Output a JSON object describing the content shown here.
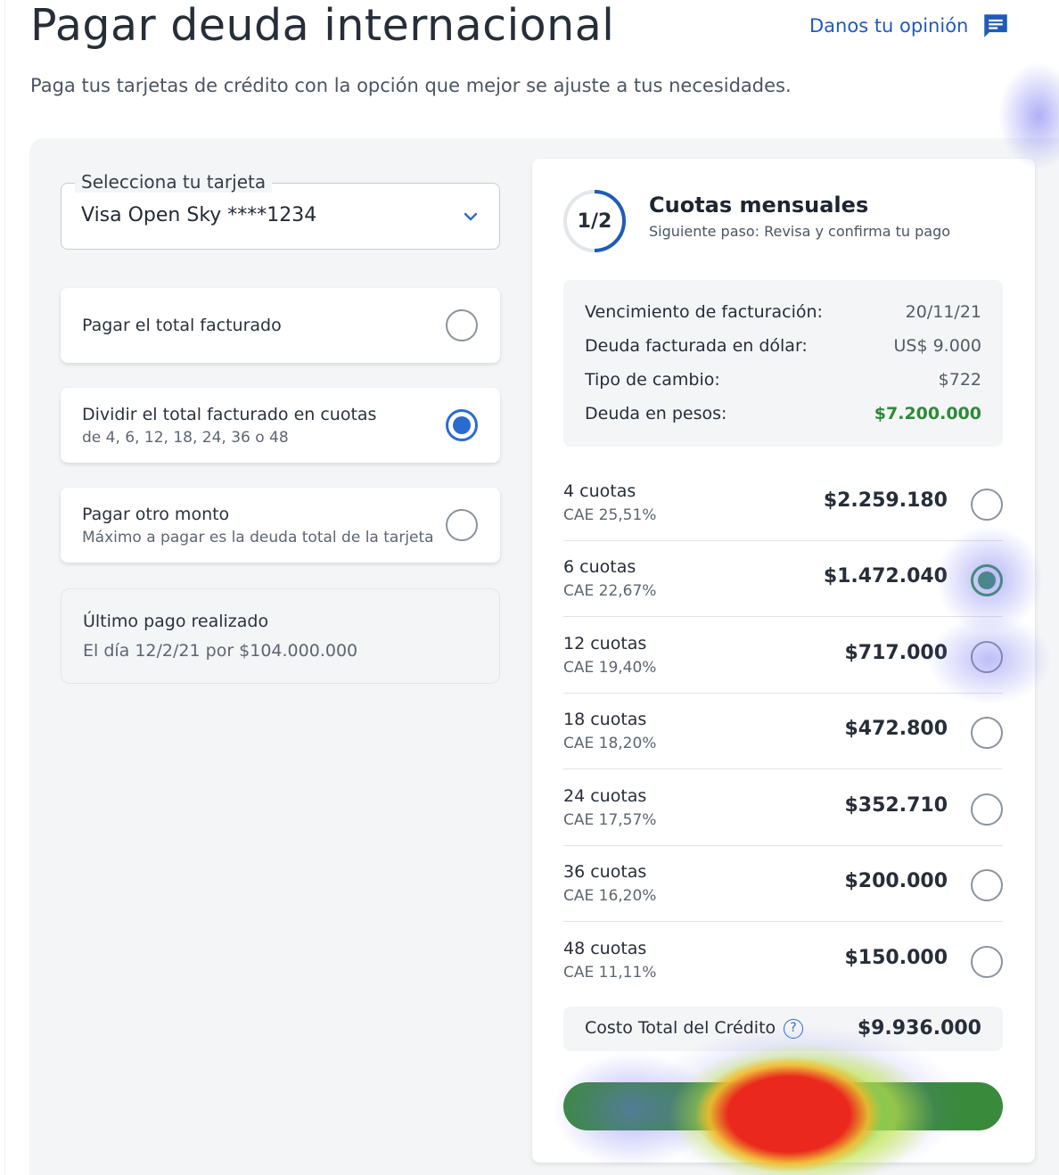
{
  "header": {
    "title": "Pagar deuda internacional",
    "feedback_label": "Danos tu opinión",
    "subtitle": "Paga tus tarjetas de crédito con la opción que mejor se ajuste a tus necesidades."
  },
  "card_select": {
    "label": "Selecciona tu tarjeta",
    "value": "Visa Open Sky ****1234"
  },
  "payment_options": [
    {
      "title": "Pagar el total facturado",
      "subtitle": "",
      "selected": false
    },
    {
      "title": "Dividir el total facturado en cuotas",
      "subtitle": "de 4, 6, 12, 18, 24, 36 o 48",
      "selected": true
    },
    {
      "title": "Pagar otro monto",
      "subtitle": "Máximo a pagar es la deuda total de la tarjeta",
      "selected": false
    }
  ],
  "last_payment": {
    "title": "Último pago realizado",
    "detail": "El día 12/2/21 por $104.000.000"
  },
  "step": {
    "indicator": "1/2",
    "progress": 0.5,
    "title": "Cuotas mensuales",
    "next": "Siguiente paso: Revisa y confirma tu pago"
  },
  "summary": [
    {
      "label": "Vencimiento de facturación:",
      "value": "20/11/21"
    },
    {
      "label": "Deuda facturada en dólar:",
      "value": "US$ 9.000"
    },
    {
      "label": "Tipo de cambio:",
      "value": "$722"
    },
    {
      "label": "Deuda en pesos:",
      "value": "$7.200.000"
    }
  ],
  "installments": [
    {
      "name": "4 cuotas",
      "cae": "CAE 25,51%",
      "amount": "$2.259.180",
      "selected": false
    },
    {
      "name": "6 cuotas",
      "cae": "CAE 22,67%",
      "amount": "$1.472.040",
      "selected": true
    },
    {
      "name": "12 cuotas",
      "cae": "CAE 19,40%",
      "amount": "$717.000",
      "selected": false
    },
    {
      "name": "18 cuotas",
      "cae": "CAE 18,20%",
      "amount": "$472.800",
      "selected": false
    },
    {
      "name": "24 cuotas",
      "cae": "CAE 17,57%",
      "amount": "$352.710",
      "selected": false
    },
    {
      "name": "36 cuotas",
      "cae": "CAE 16,20%",
      "amount": "$200.000",
      "selected": false
    },
    {
      "name": "48 cuotas",
      "cae": "CAE 11,11%",
      "amount": "$150.000",
      "selected": false
    }
  ],
  "total_credit": {
    "label": "Costo Total del Crédito",
    "help": "?",
    "value": "$9.936.000"
  },
  "colors": {
    "brand_blue": "#1f5bb8",
    "radio_blue": "#2a6bd0",
    "success_green": "#2e8a38",
    "button_green": "#3a8a3c"
  },
  "icons": {
    "feedback": "chat-bubble-icon",
    "dropdown": "chevron-down-icon",
    "help": "question-circle-icon"
  }
}
